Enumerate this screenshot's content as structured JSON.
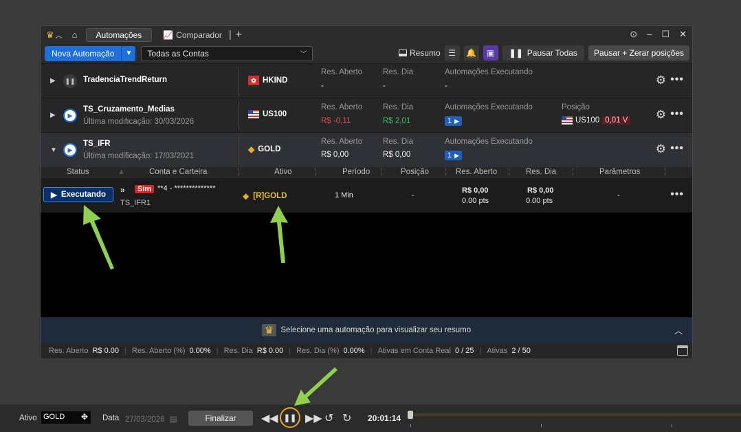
{
  "titlebar": {
    "tab_active": "Automações",
    "tab_comparador": "Comparador"
  },
  "toolbar": {
    "new_automation": "Nova Automação",
    "accounts_select": "Todas as Contas",
    "resumo": "Resumo",
    "pause_all": "Pausar Todas",
    "pause_zero": "Pausar + Zerar posições"
  },
  "labels": {
    "res_aberto": "Res. Aberto",
    "res_dia": "Res. Dia",
    "automacoes_exec": "Automações Executando",
    "posicao": "Posição"
  },
  "rows": [
    {
      "name": "TradenciaTrendReturn",
      "asset": "HKIND",
      "res_aberto": "-",
      "res_dia": "-",
      "exec": "-"
    },
    {
      "name": "TS_Cruzamento_Medias",
      "modified": "Última modificação: 30/03/2026",
      "asset": "US100",
      "res_aberto": "R$ -0,11",
      "res_dia": "R$ 2,01",
      "exec_count": "1",
      "pos_asset": "US100",
      "pos_value": "0,01 V"
    },
    {
      "name": "TS_IFR",
      "modified": "Última modificação: 17/03/2021",
      "asset": "GOLD",
      "res_aberto": "R$ 0,00",
      "res_dia": "R$ 0,00",
      "exec_count": "1"
    }
  ],
  "subheader": {
    "status": "Status",
    "conta": "Conta e Carteira",
    "ativo": "Ativo",
    "periodo": "Período",
    "posicao": "Posição",
    "res_aberto": "Res. Aberto",
    "res_dia": "Res. Dia",
    "parametros": "Parâmetros"
  },
  "exec_row": {
    "status": "Executando",
    "sim": "Sim",
    "account": "**4 - **************",
    "wallet": "TS_IFR1",
    "asset": "[R]GOLD",
    "periodo": "1 Min",
    "posicao": "-",
    "res_aberto": "R$ 0,00",
    "res_aberto_pts": "0.00 pts",
    "res_dia": "R$ 0,00",
    "res_dia_pts": "0.00 pts",
    "parametros": "-"
  },
  "summary_msg": "Selecione uma automação para visualizar seu resumo",
  "statusbar": {
    "res_aberto_lbl": "Res. Aberto",
    "res_aberto": "R$ 0.00",
    "res_aberto_pct_lbl": "Res. Aberto (%)",
    "res_aberto_pct": "0.00%",
    "res_dia_lbl": "Res. Dia",
    "res_dia": "R$ 0.00",
    "res_dia_pct_lbl": "Res. Dia (%)",
    "res_dia_pct": "0.00%",
    "ativas_real_lbl": "Ativas em Conta Real",
    "ativas_real": "0 / 25",
    "ativas_lbl": "Ativas",
    "ativas": "2 / 50"
  },
  "bottom": {
    "ativo_lbl": "Ativo",
    "ativo_val": "GOLD",
    "data_lbl": "Data",
    "data_val": "27/03/2026",
    "finalizar": "Finalizar",
    "time": "20:01:14"
  },
  "colors": {
    "accent": "#1e6fd9",
    "negative": "#e05050",
    "positive": "#3cc060",
    "highlight_ring": "#f0a020",
    "annotation_arrow": "#8fd14f"
  }
}
